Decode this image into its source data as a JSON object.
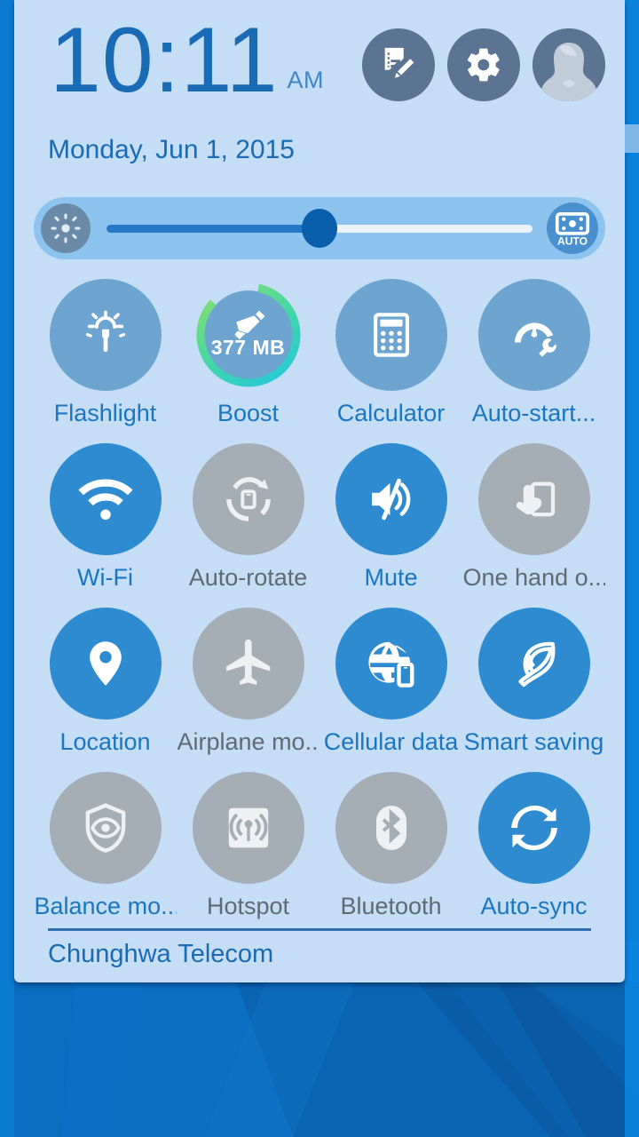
{
  "wallpaper": {
    "base_color": "#0b6fc4",
    "shade_dark": "#0a5fac",
    "shade_light": "#1281d6"
  },
  "theme": {
    "panel_bg": "#c5ddf5",
    "accent_blue": "#2e8bd0",
    "accent_label": "#1a76c0",
    "inactive_gray": "#a5adb5",
    "inactive_label": "#5f6a72",
    "app_tile": "#6ea5d0",
    "header_icon_bg": "#5a7491",
    "clock_color": "#1a6bb5",
    "slider_fill": "#2579c4",
    "slider_thumb": "#0a5fad",
    "slider_row_bg": "#8cc3ef",
    "boost_ring_green": "#8ce06a",
    "boost_ring_teal": "#3fd6ab",
    "boost_ring_cyan": "#24c6e0"
  },
  "header": {
    "time": "10:11",
    "meridiem": "AM",
    "date": "Monday, Jun 1, 2015",
    "buttons": [
      {
        "name": "edit-notes-icon",
        "label": "Edit notifications"
      },
      {
        "name": "gear-icon",
        "label": "Settings"
      },
      {
        "name": "avatar-icon",
        "label": "User profile"
      }
    ]
  },
  "brightness": {
    "icon_name": "brightness-sun-icon",
    "value_percent": 50,
    "auto_label": "AUTO",
    "auto_icon_name": "auto-brightness-sensor-icon",
    "auto_enabled": false
  },
  "tiles": [
    {
      "label": "Flashlight",
      "icon": "flashlight-icon",
      "state": "app",
      "label_state": "on"
    },
    {
      "label": "Boost",
      "icon": "boost-broom-icon",
      "state": "boost",
      "label_state": "on",
      "ring_value": "377 MB"
    },
    {
      "label": "Calculator",
      "icon": "calculator-icon",
      "state": "app",
      "label_state": "on"
    },
    {
      "label": "Auto-start...",
      "icon": "auto-start-manager-icon",
      "state": "app",
      "label_state": "on"
    },
    {
      "label": "Wi-Fi",
      "icon": "wifi-icon",
      "state": "on",
      "label_state": "on"
    },
    {
      "label": "Auto-rotate",
      "icon": "auto-rotate-icon",
      "state": "off",
      "label_state": "off"
    },
    {
      "label": "Mute",
      "icon": "mute-speaker-icon",
      "state": "on",
      "label_state": "on"
    },
    {
      "label": "One hand o...",
      "icon": "one-hand-mode-icon",
      "state": "off",
      "label_state": "off"
    },
    {
      "label": "Location",
      "icon": "location-pin-icon",
      "state": "on",
      "label_state": "on"
    },
    {
      "label": "Airplane mo...",
      "icon": "airplane-icon",
      "state": "off",
      "label_state": "off"
    },
    {
      "label": "Cellular data",
      "icon": "cellular-data-icon",
      "state": "on",
      "label_state": "on"
    },
    {
      "label": "Smart saving",
      "icon": "smart-saving-leaf-icon",
      "state": "on",
      "label_state": "on"
    },
    {
      "label": "Balance mo...",
      "icon": "balance-mode-shield-icon",
      "state": "off",
      "label_state": "on"
    },
    {
      "label": "Hotspot",
      "icon": "hotspot-icon",
      "state": "off",
      "label_state": "off"
    },
    {
      "label": "Bluetooth",
      "icon": "bluetooth-icon",
      "state": "off",
      "label_state": "off"
    },
    {
      "label": "Auto-sync",
      "icon": "auto-sync-icon",
      "state": "on",
      "label_state": "on"
    }
  ],
  "footer": {
    "carrier": "Chunghwa Telecom"
  }
}
